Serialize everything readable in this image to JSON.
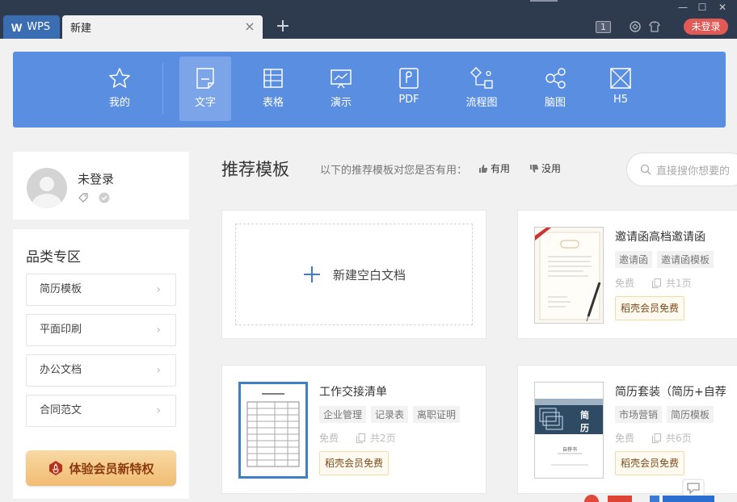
{
  "titlebar": {
    "wps_tab_label": "WPS",
    "doc_tab_label": "新建",
    "page_count_badge": "1",
    "login_button": "未登录"
  },
  "categories": [
    {
      "label": "我的",
      "icon": "star-icon"
    },
    {
      "label": "文字",
      "icon": "document-icon",
      "active": true
    },
    {
      "label": "表格",
      "icon": "spreadsheet-icon"
    },
    {
      "label": "演示",
      "icon": "presentation-icon"
    },
    {
      "label": "PDF",
      "icon": "pdf-icon"
    },
    {
      "label": "流程图",
      "icon": "flowchart-icon"
    },
    {
      "label": "脑图",
      "icon": "mindmap-icon"
    },
    {
      "label": "H5",
      "icon": "h5-icon"
    }
  ],
  "user": {
    "name": "未登录"
  },
  "category_panel": {
    "title": "品类专区",
    "items": [
      "简历模板",
      "平面印刷",
      "办公文档",
      "合同范文"
    ],
    "vip_button": "体验会员新特权"
  },
  "recommend": {
    "title": "推荐模板",
    "question": "以下的推荐模板对您是否有用：",
    "useful_label": "有用",
    "useless_label": "没用",
    "search_placeholder": "直接搜你想要的"
  },
  "blank_doc": {
    "label": "新建空白文档"
  },
  "templates": [
    {
      "name": "邀请函高档邀请函",
      "tags": [
        "邀请函",
        "邀请函模板"
      ],
      "price": "免费",
      "pages": "共1页",
      "vip_label": "稻壳会员免费"
    },
    {
      "name": "工作交接清单",
      "tags": [
        "企业管理",
        "记录表",
        "离职证明"
      ],
      "price": "免费",
      "pages": "共2页",
      "vip_label": "稻壳会员免费"
    },
    {
      "name": "简历套装（简历+自荐",
      "tags": [
        "市场营销",
        "简历模板"
      ],
      "price": "免费",
      "pages": "共6页",
      "vip_label": "稻壳会员免费",
      "thumb_text": [
        "简",
        "历"
      ],
      "thumb_caption": "自荐书"
    }
  ],
  "colors": {
    "titlebar": "#2e3a4e",
    "category_bar": "#5a8ee0",
    "login_button": "#e25a55",
    "vip_button": "#f0bc72"
  }
}
